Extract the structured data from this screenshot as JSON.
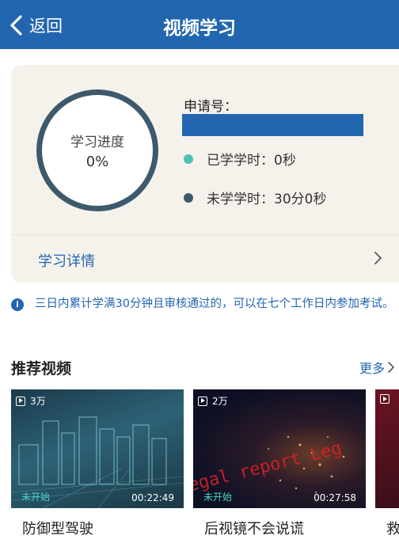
{
  "nav": {
    "back_label": "返回",
    "title": "视频学习"
  },
  "progress": {
    "label": "学习进度",
    "value": "0%",
    "apply_label": "申请号：",
    "learned": "已学学时：0秒",
    "unlearned": "未学学时：30分0秒",
    "detail_label": "学习详情"
  },
  "notice": {
    "text": "三日内累计学满30分钟且审核通过的，可以在七个工作日内参加考试。"
  },
  "recommend": {
    "title": "推荐视频",
    "more": "更多",
    "videos": [
      {
        "title": "防御型驾驶",
        "views": "3万",
        "status": "未开始",
        "duration": "00:22:49"
      },
      {
        "title": "后视镜不会说谎",
        "views": "2万",
        "status": "未开始",
        "duration": "00:27:58",
        "overlay": "egal report  Leg"
      },
      {
        "title": "救"
      }
    ]
  },
  "colors": {
    "primary": "#2266b0",
    "learned_dot": "#4cc1b4",
    "unlearned_dot": "#3d5a6c",
    "card_bg": "#f5f2ec"
  }
}
